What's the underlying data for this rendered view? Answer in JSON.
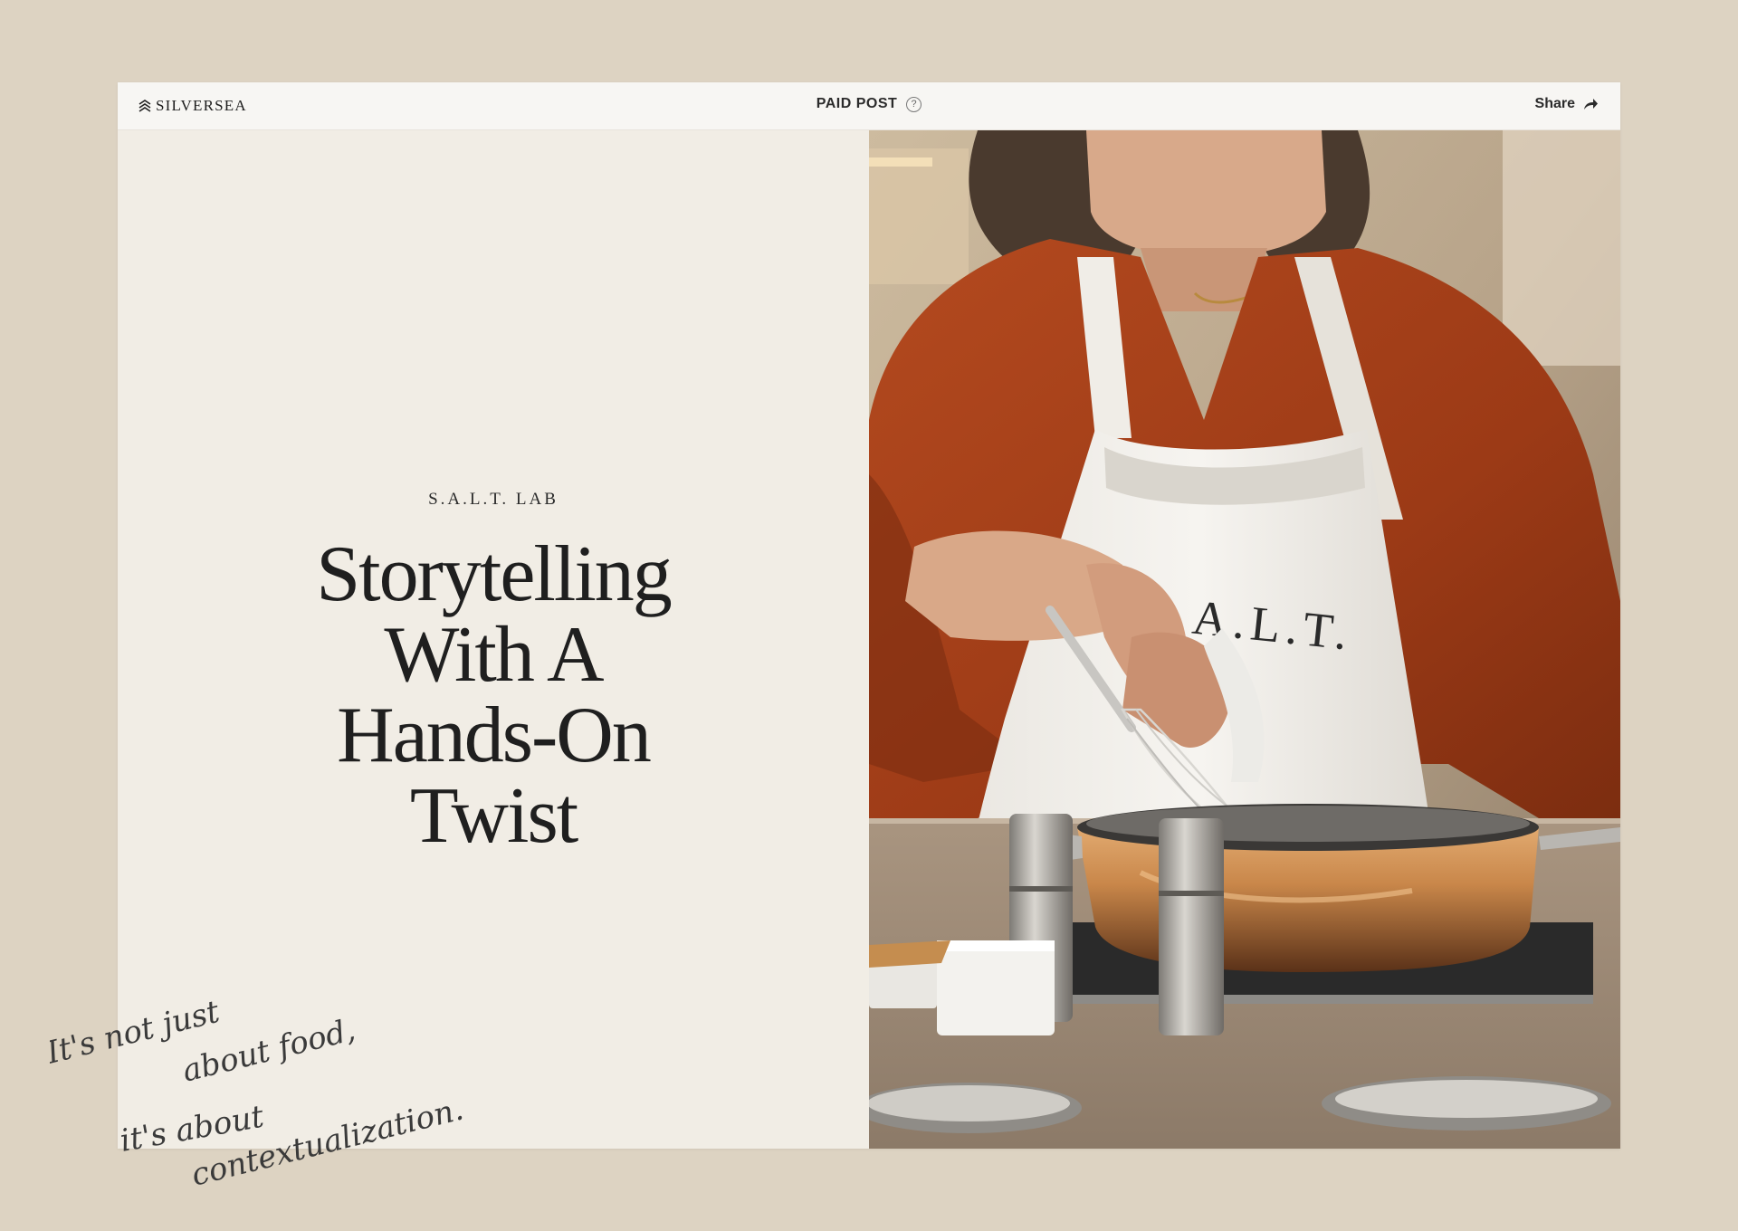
{
  "brand": {
    "logo_text": "SILVERSEA"
  },
  "header": {
    "label": "PAID POST",
    "help": "?",
    "share_label": "Share"
  },
  "article": {
    "eyebrow": "S.A.L.T. LAB",
    "headline_lines": [
      "Storytelling",
      "With A",
      "Hands-On",
      "Twist"
    ]
  },
  "photo": {
    "apron_text": "S.A.L.T."
  },
  "handwriting": {
    "lines": [
      "It's not just",
      "about food,",
      "it's about",
      "contextualization."
    ]
  },
  "colors": {
    "page_background": "#ddd3c2",
    "panel_background": "#f1ede5",
    "header_background": "#f7f6f3",
    "text_dark": "#1f1f1f",
    "shirt_rust": "#a8421c",
    "copper": "#c9874a"
  },
  "icons": {
    "help": "question-circle-icon",
    "share": "share-arrow-icon",
    "logo": "silversea-mark-icon"
  }
}
